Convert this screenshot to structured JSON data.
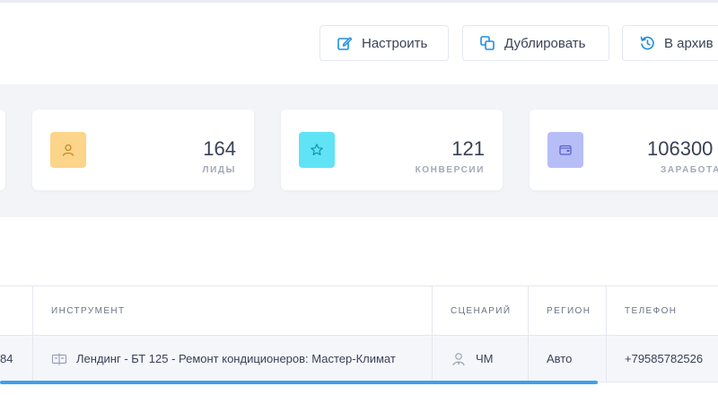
{
  "toolbar": {
    "configure_label": "Настроить",
    "duplicate_label": "Дублировать",
    "archive_label": "В архив"
  },
  "stats": {
    "leads": {
      "value": "164",
      "label": "ЛИДЫ",
      "icon": "user-icon",
      "color": "#fcd48a"
    },
    "conversions": {
      "value": "121",
      "label": "КОНВЕРСИИ",
      "icon": "star-icon",
      "color": "#5fe3f5"
    },
    "earned": {
      "value": "106300",
      "label": "ЗАРАБОТАН",
      "icon": "wallet-icon",
      "color": "#b7bdf7"
    }
  },
  "table": {
    "headers": {
      "instrument": "ИНСТРУМЕНТ",
      "scenario": "СЦЕНАРИЙ",
      "region": "РЕГИОН",
      "phone": "ТЕЛЕФОН"
    },
    "rows": [
      {
        "id": "84",
        "instrument": "Лендинг - БТ 125 - Ремонт кондиционеров: Мастер-Климат",
        "scenario": "ЧМ",
        "region": "Авто",
        "phone": "+79585782526"
      }
    ]
  },
  "colors": {
    "accent": "#3ea0ec",
    "background_band": "#f2f4f8"
  }
}
